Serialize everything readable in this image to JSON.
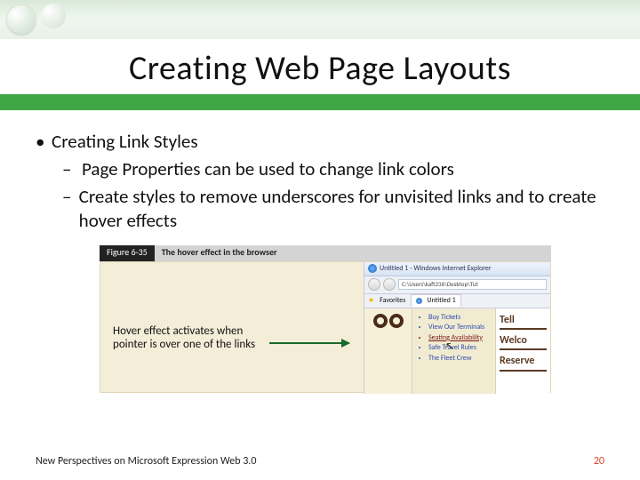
{
  "title": "Creating Web Page Layouts",
  "bullets": {
    "main": "Creating Link Styles",
    "sub1": "Page Properties can be used to change link colors",
    "sub2": "Create styles to remove underscores for unvisited links and to create hover effects"
  },
  "figure": {
    "num": "Figure 6-35",
    "caption": "The hover effect in the browser",
    "callout": "Hover effect activates when pointer is over one of the links",
    "browser": {
      "title": "Untitled 1 - Windows Internet Explorer",
      "address": "C:\\Users\\kaft236\\Desktop\\Tut",
      "favorites": "Favorites",
      "tab": "Untitled 1",
      "links": [
        "Buy Tickets",
        "View Our Terminals",
        "Seating Availability",
        "Safe Travel Rules",
        "The Fleet Crew"
      ],
      "headlines": [
        "Tell",
        "Welco",
        "Reserve"
      ]
    }
  },
  "footer": {
    "left": "New Perspectives on Microsoft Expression Web 3.0",
    "right": "20"
  }
}
